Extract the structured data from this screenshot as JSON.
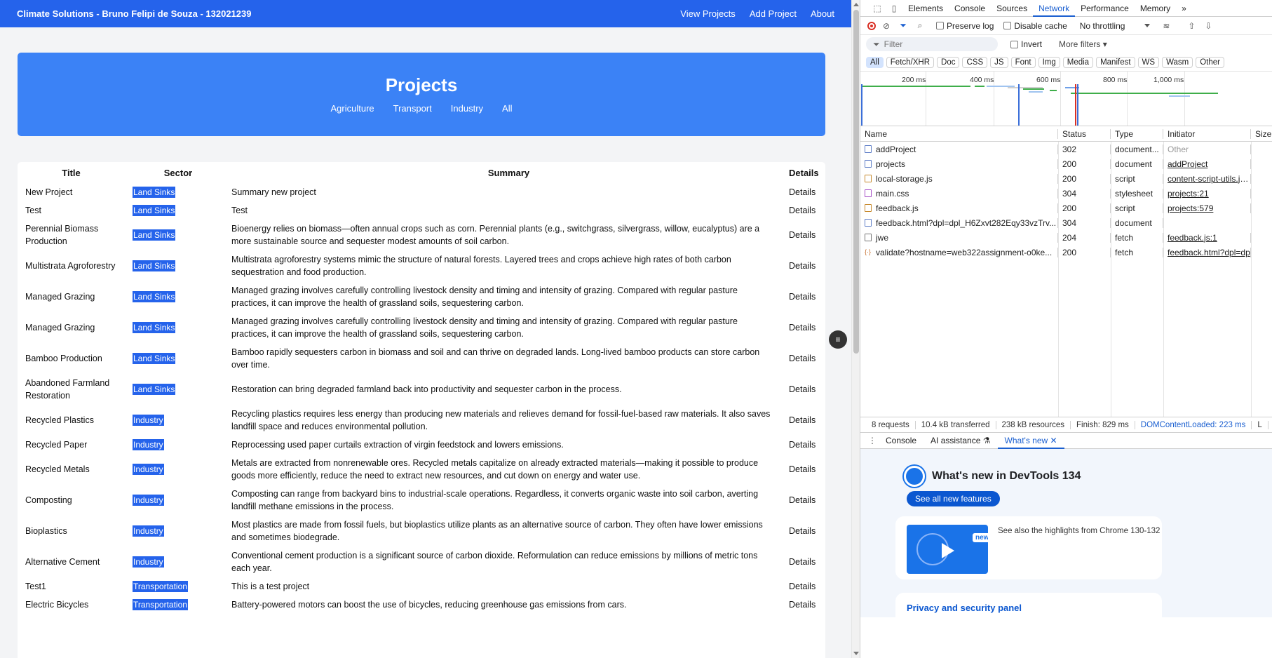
{
  "app": {
    "brand": "Climate Solutions - Bruno Felipi de Souza - 132021239",
    "nav": [
      "View Projects",
      "Add Project",
      "About"
    ],
    "hero_title": "Projects",
    "filters": [
      "Agriculture",
      "Transport",
      "Industry",
      "All"
    ],
    "table": {
      "headers": {
        "title": "Title",
        "sector": "Sector",
        "summary": "Summary",
        "details": "Details"
      },
      "details_label": "Details",
      "rows": [
        {
          "title": "New Project",
          "sector": "Land Sinks",
          "summary": "Summary new project"
        },
        {
          "title": "Test",
          "sector": "Land Sinks",
          "summary": "Test"
        },
        {
          "title": "Perennial Biomass Production",
          "sector": "Land Sinks",
          "summary": "Bioenergy relies on biomass—often annual crops such as corn. Perennial plants (e.g., switchgrass, silvergrass, willow, eucalyptus) are a more sustainable source and sequester modest amounts of soil carbon."
        },
        {
          "title": "Multistrata Agroforestry",
          "sector": "Land Sinks",
          "summary": "Multistrata agroforestry systems mimic the structure of natural forests. Layered trees and crops achieve high rates of both carbon sequestration and food production."
        },
        {
          "title": "Managed Grazing",
          "sector": "Land Sinks",
          "summary": "Managed grazing involves carefully controlling livestock density and timing and intensity of grazing. Compared with regular pasture practices, it can improve the health of grassland soils, sequestering carbon."
        },
        {
          "title": "Managed Grazing",
          "sector": "Land Sinks",
          "summary": "Managed grazing involves carefully controlling livestock density and timing and intensity of grazing. Compared with regular pasture practices, it can improve the health of grassland soils, sequestering carbon."
        },
        {
          "title": "Bamboo Production",
          "sector": "Land Sinks",
          "summary": "Bamboo rapidly sequesters carbon in biomass and soil and can thrive on degraded lands. Long-lived bamboo products can store carbon over time."
        },
        {
          "title": "Abandoned Farmland Restoration",
          "sector": "Land Sinks",
          "summary": "Restoration can bring degraded farmland back into productivity and sequester carbon in the process."
        },
        {
          "title": "Recycled Plastics",
          "sector": "Industry",
          "summary": "Recycling plastics requires less energy than producing new materials and relieves demand for fossil-fuel-based raw materials. It also saves landfill space and reduces environmental pollution."
        },
        {
          "title": "Recycled Paper",
          "sector": "Industry",
          "summary": "Reprocessing used paper curtails extraction of virgin feedstock and lowers emissions."
        },
        {
          "title": "Recycled Metals",
          "sector": "Industry",
          "summary": "Metals are extracted from nonrenewable ores. Recycled metals capitalize on already extracted materials—making it possible to produce goods more efficiently, reduce the need to extract new resources, and cut down on energy and water use."
        },
        {
          "title": "Composting",
          "sector": "Industry",
          "summary": "Composting can range from backyard bins to industrial-scale operations. Regardless, it converts organic waste into soil carbon, averting landfill methane emissions in the process."
        },
        {
          "title": "Bioplastics",
          "sector": "Industry",
          "summary": "Most plastics are made from fossil fuels, but bioplastics utilize plants as an alternative source of carbon. They often have lower emissions and sometimes biodegrade."
        },
        {
          "title": "Alternative Cement",
          "sector": "Industry",
          "summary": "Conventional cement production is a significant source of carbon dioxide. Reformulation can reduce emissions by millions of metric tons each year."
        },
        {
          "title": "Test1",
          "sector": "Transportation",
          "summary": "This is a test project"
        },
        {
          "title": "Electric Bicycles",
          "sector": "Transportation",
          "summary": "Battery-powered motors can boost the use of bicycles, reducing greenhouse gas emissions from cars."
        }
      ]
    }
  },
  "devtools": {
    "tabs": [
      "Elements",
      "Console",
      "Sources",
      "Network",
      "Performance",
      "Memory"
    ],
    "more_tabs": "»",
    "toolbar": {
      "preserve_log": "Preserve log",
      "disable_cache": "Disable cache",
      "throttling": "No throttling"
    },
    "filter": {
      "placeholder": "Filter",
      "invert": "Invert",
      "more_filters": "More filters"
    },
    "types": [
      "All",
      "Fetch/XHR",
      "Doc",
      "CSS",
      "JS",
      "Font",
      "Img",
      "Media",
      "Manifest",
      "WS",
      "Wasm",
      "Other"
    ],
    "timeline_ticks": [
      "200 ms",
      "400 ms",
      "600 ms",
      "800 ms",
      "1,000 ms"
    ],
    "columns": [
      "Name",
      "Status",
      "Type",
      "Initiator",
      "Size"
    ],
    "requests": [
      {
        "name": "addProject",
        "status": "302",
        "type": "document...",
        "initiator": "Other",
        "icon": "doc"
      },
      {
        "name": "projects",
        "status": "200",
        "type": "document",
        "initiator": "addProject",
        "icon": "doc"
      },
      {
        "name": "local-storage.js",
        "status": "200",
        "type": "script",
        "initiator": "content-script-utils.js:1",
        "icon": "js"
      },
      {
        "name": "main.css",
        "status": "304",
        "type": "stylesheet",
        "initiator": "projects:21",
        "icon": "css"
      },
      {
        "name": "feedback.js",
        "status": "200",
        "type": "script",
        "initiator": "projects:579",
        "icon": "js"
      },
      {
        "name": "feedback.html?dpl=dpl_H6Zxvt282Eqy33vzTrv...",
        "status": "304",
        "type": "document",
        "initiator": "",
        "icon": "doc"
      },
      {
        "name": "jwe",
        "status": "204",
        "type": "fetch",
        "initiator": "feedback.js:1",
        "icon": "fetch"
      },
      {
        "name": "validate?hostname=web322assignment-o0ke...",
        "status": "200",
        "type": "fetch",
        "initiator": "feedback.html?dpl=dp",
        "icon": "xhr"
      }
    ],
    "status_bar": [
      "8 requests",
      "10.4 kB transferred",
      "238 kB resources",
      "Finish: 829 ms",
      "DOMContentLoaded: 223 ms",
      "L"
    ],
    "drawer": {
      "tabs": [
        "Console",
        "AI assistance",
        "What's new"
      ],
      "whats_new_title": "What's new in DevTools 134",
      "see_all": "See all new features",
      "new_badge": "new",
      "highlight_text": "See also the highlights from Chrome 130-132",
      "privacy_title": "Privacy and security panel"
    }
  }
}
